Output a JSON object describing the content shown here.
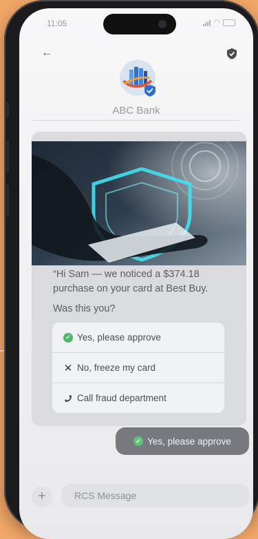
{
  "status_bar": {
    "time": "11:05"
  },
  "header": {
    "brand": "ABC Bank",
    "back_icon": "arrow-left-icon",
    "verified_icon": "shield-check-icon"
  },
  "message": {
    "hero_image": "security-shield-hand-image",
    "line1": "“Hi Sam — we noticed a $374.18 purchase on your card at Best Buy.",
    "line2": "Was this you?",
    "options": [
      {
        "label": "Yes, please approve",
        "icon": "check-circle-icon"
      },
      {
        "label": "No, freeze my card",
        "icon": "x-icon"
      },
      {
        "label": "Call fraud department",
        "icon": "phone-icon"
      }
    ]
  },
  "reply": {
    "label": "Yes, please approve",
    "icon": "check-circle-icon"
  },
  "composer": {
    "placeholder": "RCS Message",
    "add_icon": "plus-icon"
  },
  "colors": {
    "background": "#f3a868",
    "approve_green": "#4cb86a",
    "bank_blue": "#2f6fd0"
  }
}
